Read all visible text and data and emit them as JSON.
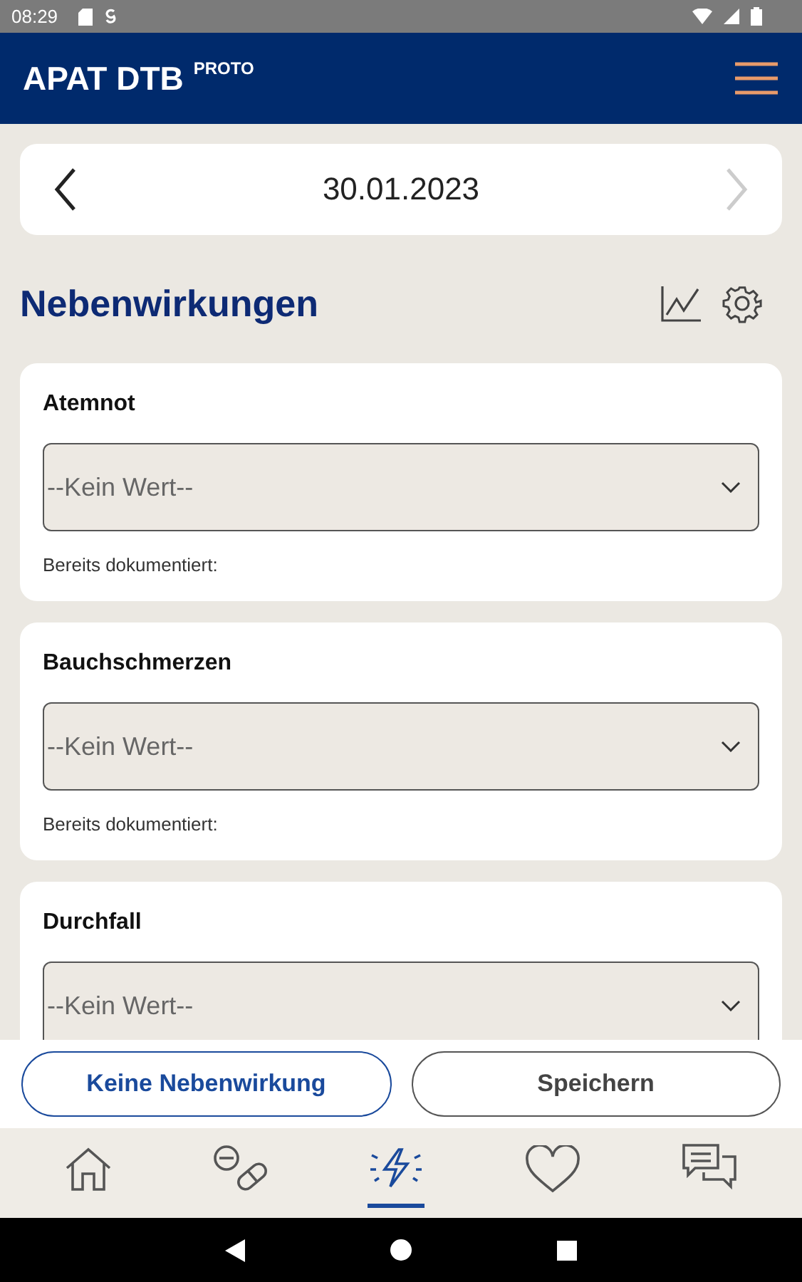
{
  "status_bar": {
    "time": "08:29"
  },
  "app_bar": {
    "title": "APAT DTB",
    "superscript": "PROTO"
  },
  "date_nav": {
    "date": "30.01.2023",
    "prev_disabled": false,
    "next_disabled": true
  },
  "section": {
    "title": "Nebenwirkungen"
  },
  "symptoms": [
    {
      "name": "Atemnot",
      "placeholder": "--Kein Wert--",
      "note": "Bereits dokumentiert:"
    },
    {
      "name": "Bauchschmerzen",
      "placeholder": "--Kein Wert--",
      "note": "Bereits dokumentiert:"
    },
    {
      "name": "Durchfall",
      "placeholder": "--Kein Wert--"
    }
  ],
  "actions": [
    {
      "label": "Keine Nebenwirkung",
      "kind": "primary"
    },
    {
      "label": "Speichern",
      "kind": "secondary"
    }
  ],
  "bottom_nav": [
    {
      "kind": "home",
      "selected": false
    },
    {
      "kind": "medication",
      "selected": false
    },
    {
      "kind": "side_effects",
      "selected": true
    },
    {
      "kind": "health",
      "selected": false
    },
    {
      "kind": "chat",
      "selected": false
    }
  ]
}
